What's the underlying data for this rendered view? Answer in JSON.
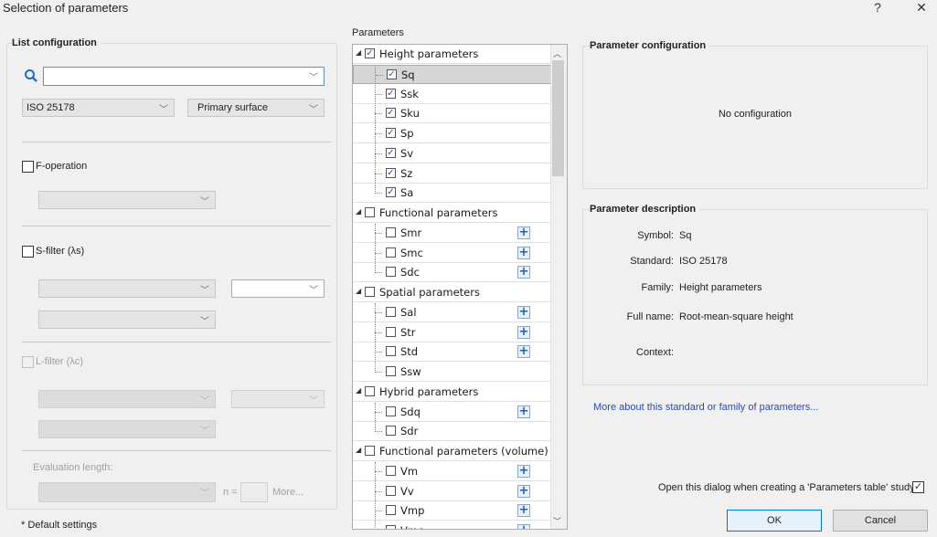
{
  "window": {
    "title": "Selection of parameters",
    "help": "?",
    "close": "✕"
  },
  "list_config": {
    "title": "List configuration",
    "search_value": "",
    "standard": "ISO 25178",
    "surface": "Primary surface",
    "f_operation": "F-operation",
    "s_filter": "S-filter (λs)",
    "l_filter": "L-filter (λc)",
    "eval_length": "Evaluation length:",
    "n_eq": "n =",
    "more": "More...",
    "default_settings": "* Default settings"
  },
  "parameters": {
    "label": "Parameters",
    "groups": [
      {
        "name": "Height parameters",
        "checked": true,
        "items": [
          {
            "name": "Sq",
            "checked": true,
            "selected": true
          },
          {
            "name": "Ssk",
            "checked": true
          },
          {
            "name": "Sku",
            "checked": true
          },
          {
            "name": "Sp",
            "checked": true
          },
          {
            "name": "Sv",
            "checked": true
          },
          {
            "name": "Sz",
            "checked": true
          },
          {
            "name": "Sa",
            "checked": true
          }
        ]
      },
      {
        "name": "Functional parameters",
        "checked": false,
        "items": [
          {
            "name": "Smr",
            "checked": false,
            "plus": true
          },
          {
            "name": "Smc",
            "checked": false,
            "plus": true
          },
          {
            "name": "Sdc",
            "checked": false,
            "plus": true
          }
        ]
      },
      {
        "name": "Spatial parameters",
        "checked": false,
        "items": [
          {
            "name": "Sal",
            "checked": false,
            "plus": true
          },
          {
            "name": "Str",
            "checked": false,
            "plus": true
          },
          {
            "name": "Std",
            "checked": false,
            "plus": true
          },
          {
            "name": "Ssw",
            "checked": false
          }
        ]
      },
      {
        "name": "Hybrid parameters",
        "checked": false,
        "items": [
          {
            "name": "Sdq",
            "checked": false,
            "plus": true
          },
          {
            "name": "Sdr",
            "checked": false
          }
        ]
      },
      {
        "name": "Functional parameters (volume)",
        "checked": false,
        "items": [
          {
            "name": "Vm",
            "checked": false,
            "plus": true
          },
          {
            "name": "Vv",
            "checked": false,
            "plus": true
          },
          {
            "name": "Vmp",
            "checked": false,
            "plus": true
          },
          {
            "name": "Vmc",
            "checked": false,
            "plus": true
          }
        ]
      }
    ]
  },
  "param_config": {
    "title": "Parameter configuration",
    "empty": "No configuration"
  },
  "param_desc": {
    "title": "Parameter description",
    "symbol_k": "Symbol:",
    "symbol_v": "Sq",
    "standard_k": "Standard:",
    "standard_v": "ISO 25178",
    "family_k": "Family:",
    "family_v": "Height parameters",
    "fullname_k": "Full name:",
    "fullname_v": "Root-mean-square height",
    "context_k": "Context:",
    "context_v": ""
  },
  "more_link": "More about this standard or family of parameters...",
  "open_dialog": {
    "label": "Open this dialog when creating a 'Parameters table' study",
    "checked": true
  },
  "buttons": {
    "ok": "OK",
    "cancel": "Cancel"
  }
}
